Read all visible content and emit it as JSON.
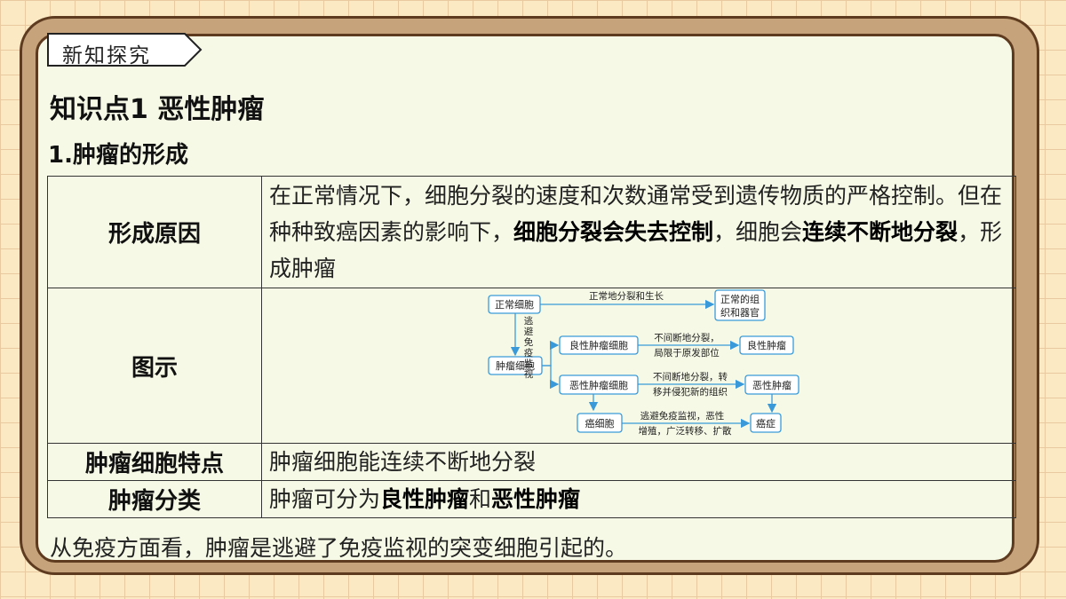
{
  "section_tag": "新知探究",
  "topic_title": "知识点1  恶性肿瘤",
  "sub_title": "1.肿瘤的形成",
  "table": {
    "row1": {
      "header": "形成原因",
      "text_1": "在正常情况下，细胞分裂的速度和次数通常受到遗传物质的严格控制。但在种种致癌因素的影响下，",
      "bold_1": "细胞分裂会失去控制",
      "text_2": "，细胞会",
      "bold_2": "连续不断地分裂",
      "text_3": "，形成肿瘤"
    },
    "row2": {
      "header": "图示"
    },
    "row3": {
      "header": "肿瘤细胞特点",
      "text": "肿瘤细胞能连续不断地分裂"
    },
    "row4": {
      "header": "肿瘤分类",
      "text_1": "肿瘤可分为",
      "bold_1": "良性肿瘤",
      "text_2": "和",
      "bold_2": "恶性肿瘤"
    }
  },
  "diagram": {
    "nodes": {
      "normal_cell": "正常细胞",
      "normal_tissue_1": "正常的组",
      "normal_tissue_2": "织和器官",
      "tumor_cell": "肿瘤细胞",
      "benign_cell": "良性肿瘤细胞",
      "benign_tumor": "良性肿瘤",
      "malignant_cell": "恶性肿瘤细胞",
      "malignant_tumor": "恶性肿瘤",
      "cancer_cell": "癌细胞",
      "cancer": "癌症"
    },
    "labels": {
      "normal_growth": "正常地分裂和生长",
      "escape_1": "逃",
      "escape_2": "避",
      "escape_3": "免",
      "escape_4": "疫",
      "escape_5": "监",
      "escape_6": "视",
      "benign_1": "不间断地分裂，",
      "benign_2": "局限于原发部位",
      "malignant_1": "不间断地分裂，转",
      "malignant_2": "移并侵犯新的组织",
      "cancer_1": "逃避免疫监视，恶性",
      "cancer_2": "增殖，广泛转移、扩散"
    }
  },
  "footer": "从免疫方面看，肿瘤是逃避了免疫监视的突变细胞引起的。",
  "colors": {
    "background": "#fbe9c4",
    "frame": "#c6a37a",
    "board": "#f6f9e6",
    "diagram_accent": "#3a9ad9"
  }
}
